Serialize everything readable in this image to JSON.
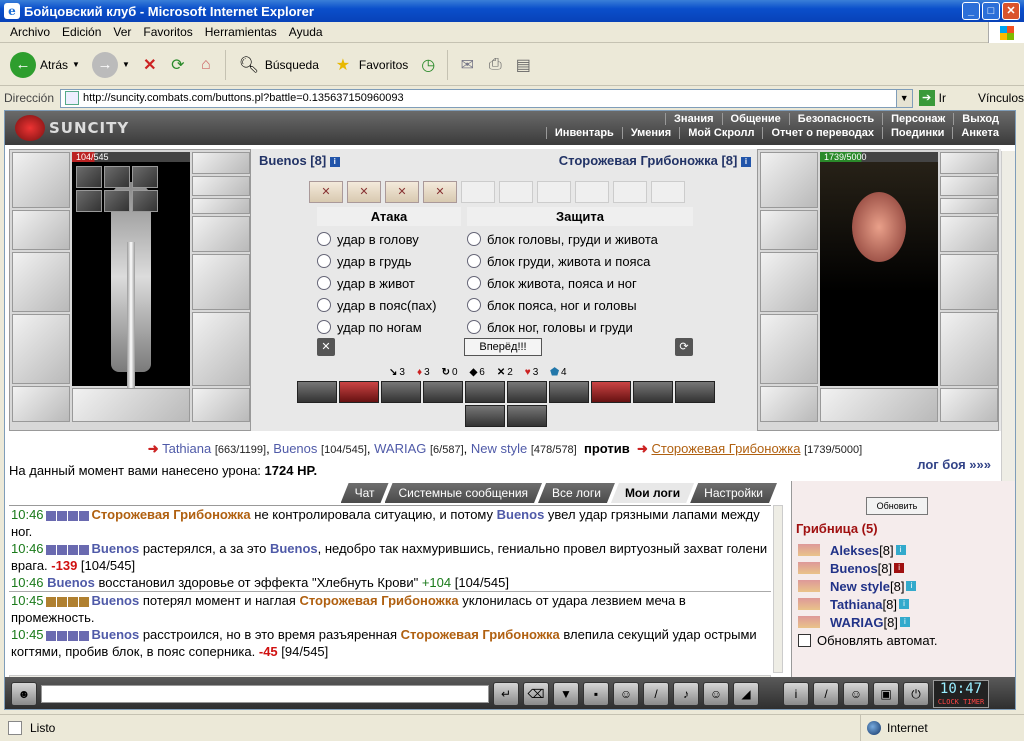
{
  "window": {
    "title": "Бойцовский клуб - Microsoft Internet Explorer"
  },
  "menu": [
    "Archivo",
    "Edición",
    "Ver",
    "Favoritos",
    "Herramientas",
    "Ayuda"
  ],
  "toolbar": {
    "back": "Atrás",
    "search": "Búsqueda",
    "favorites": "Favoritos"
  },
  "address": {
    "label": "Dirección",
    "url": "http://suncity.combats.com/buttons.pl?battle=0.135637150960093",
    "go": "Ir",
    "links": "Vínculos"
  },
  "game": {
    "logo": "SUNCITY",
    "nav_top": [
      "Знания",
      "Общение",
      "Безопасность",
      "Персонаж",
      "Выход"
    ],
    "nav_bottom": [
      "Инвентарь",
      "Умения",
      "Мой Скролл",
      "Отчет о переводах",
      "Поединки",
      "Анкета"
    ],
    "player": {
      "name": "Buenos [8]",
      "hp": "104/545"
    },
    "enemy": {
      "name": "Сторожевая Грибоножка [8]",
      "hp": "1739/5000"
    },
    "attack_header": "Атака",
    "defense_header": "Защита",
    "attacks": [
      "удар в голову",
      "удар в грудь",
      "удар в живот",
      "удар в пояс(пах)",
      "удар по ногам"
    ],
    "defenses": [
      "блок головы, груди и живота",
      "блок груди, живота и пояса",
      "блок живота, пояса и ног",
      "блок пояса, ног и головы",
      "блок ног, головы и груди"
    ],
    "forward_button": "Вперёд!!!",
    "counts": [
      "3",
      "3",
      "0",
      "6",
      "2",
      "3",
      "4"
    ],
    "team": {
      "members": [
        {
          "name": "Tathiana",
          "hp": "[663/1199]"
        },
        {
          "name": "Buenos",
          "hp": "[104/545]"
        },
        {
          "name": "WARIAG",
          "hp": "[6/587]"
        },
        {
          "name": "New style",
          "hp": "[478/578]"
        }
      ],
      "vs": "против",
      "enemy_name": "Сторожевая Грибоножка",
      "enemy_hp": "[1739/5000]"
    },
    "damage_text": "На данный момент вами нанесено урона:",
    "damage_value": "1724 HP.",
    "log_link": "лог боя »»»"
  },
  "chat": {
    "tabs": [
      "Чат",
      "Системные сообщения",
      "Все логи",
      "Мои логи",
      "Настройки"
    ],
    "active_tab": "Мои логи",
    "messages": [
      {
        "time": "10:46",
        "a": "Сторожевая Грибоножка",
        "t1": " не контролировала ситуацию, и потому ",
        "b": "Buenos",
        "t2": " увел удар грязными лапами между ног.",
        "dmg": ""
      },
      {
        "time": "10:46",
        "a": "Buenos",
        "t1": " растерялся, а за это ",
        "b": "Buenos",
        "t2": ", недобро так нахмурившись, гениально провел виртуозный захват голени врага. ",
        "dmg": "-139",
        "hp": " [104/545]"
      },
      {
        "time": "10:46",
        "a": "Buenos",
        "t1": " восстановил здоровье от эффекта \"Хлебнуть Крови\" ",
        "heal": "+104",
        "hp": " [104/545]"
      },
      {
        "time": "10:45",
        "a": "Buenos",
        "t1": " потерял момент и наглая ",
        "b": "Сторожевая Грибоножка",
        "t2": " уклонилась от удара лезвием меча в промежность."
      },
      {
        "time": "10:45",
        "a": "Buenos",
        "t1": " расстроился, но в это время разъяренная ",
        "b": "Сторожевая Грибоножка",
        "t2": " влепила секущий удар острыми когтями, пробив блок, в пояс соперника. ",
        "dmg": "-45",
        "hp": " [94/545]"
      }
    ]
  },
  "room": {
    "refresh": "Обновить",
    "title": "Грибница (5)",
    "users": [
      {
        "name": "Alekses",
        "level": "[8]"
      },
      {
        "name": "Buenos",
        "level": "[8]"
      },
      {
        "name": "New style",
        "level": "[8]"
      },
      {
        "name": "Tathiana",
        "level": "[8]"
      },
      {
        "name": "WARIAG",
        "level": "[8]"
      }
    ],
    "auto_refresh": "Обновлять автомат."
  },
  "bottom": {
    "clock": "10:47",
    "clock_label": "CLOCK",
    "timer_label": "TIMER"
  },
  "status": {
    "left": "Listo",
    "zone": "Internet"
  }
}
